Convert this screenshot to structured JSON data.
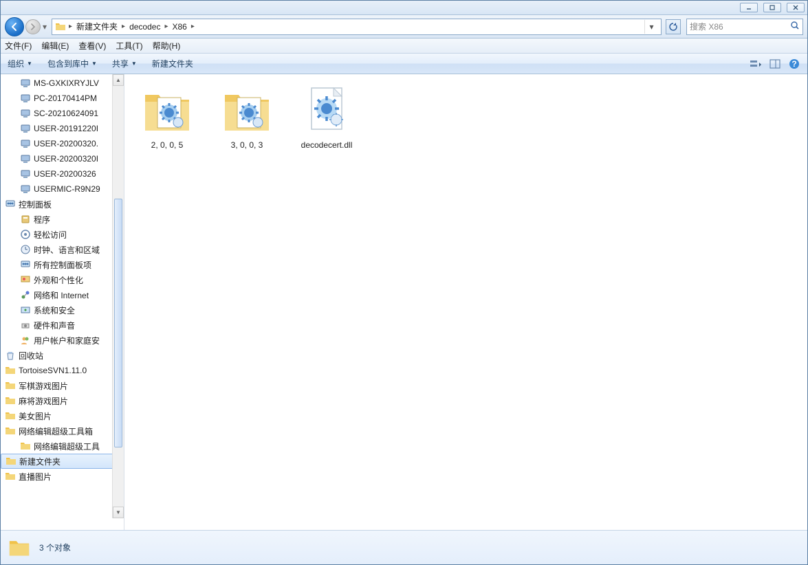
{
  "titlebar": {},
  "breadcrumb": [
    "新建文件夹",
    "decodec",
    "X86"
  ],
  "search_placeholder": "搜索 X86",
  "menubar": [
    "文件(F)",
    "编辑(E)",
    "查看(V)",
    "工具(T)",
    "帮助(H)"
  ],
  "toolbar": {
    "organize": "组织",
    "include": "包含到库中",
    "share": "共享",
    "newfolder": "新建文件夹"
  },
  "sidebar": [
    {
      "label": "MS-GXKIXRYJLV",
      "icon": "computer",
      "indent": 1
    },
    {
      "label": "PC-20170414PM",
      "icon": "computer",
      "indent": 1
    },
    {
      "label": "SC-20210624091",
      "icon": "computer",
      "indent": 1
    },
    {
      "label": "USER-20191220I",
      "icon": "computer",
      "indent": 1
    },
    {
      "label": "USER-20200320.",
      "icon": "computer",
      "indent": 1
    },
    {
      "label": "USER-20200320I",
      "icon": "computer",
      "indent": 1
    },
    {
      "label": "USER-20200326",
      "icon": "computer",
      "indent": 1
    },
    {
      "label": "USERMIC-R9N29",
      "icon": "computer",
      "indent": 1
    },
    {
      "label": "控制面板",
      "icon": "control-panel",
      "indent": 0
    },
    {
      "label": "程序",
      "icon": "programs",
      "indent": 1
    },
    {
      "label": "轻松访问",
      "icon": "ease",
      "indent": 1
    },
    {
      "label": "时钟、语言和区域",
      "icon": "clock",
      "indent": 1
    },
    {
      "label": "所有控制面板项",
      "icon": "control-panel",
      "indent": 1
    },
    {
      "label": "外观和个性化",
      "icon": "appearance",
      "indent": 1
    },
    {
      "label": "网络和 Internet",
      "icon": "network",
      "indent": 1
    },
    {
      "label": "系统和安全",
      "icon": "system",
      "indent": 1
    },
    {
      "label": "硬件和声音",
      "icon": "hardware",
      "indent": 1
    },
    {
      "label": "用户帐户和家庭安",
      "icon": "users",
      "indent": 1
    },
    {
      "label": "回收站",
      "icon": "recycle",
      "indent": 0
    },
    {
      "label": "TortoiseSVN1.11.0",
      "icon": "folder",
      "indent": 0
    },
    {
      "label": "军棋游戏图片",
      "icon": "folder",
      "indent": 0
    },
    {
      "label": "麻将游戏图片",
      "icon": "folder",
      "indent": 0
    },
    {
      "label": "美女图片",
      "icon": "folder",
      "indent": 0
    },
    {
      "label": "网络编辑超级工具箱",
      "icon": "folder",
      "indent": 0
    },
    {
      "label": "网络编辑超级工具",
      "icon": "folder",
      "indent": 1
    },
    {
      "label": "新建文件夹",
      "icon": "folder",
      "indent": 0,
      "selected": true
    },
    {
      "label": "直播图片",
      "icon": "folder",
      "indent": 0
    }
  ],
  "files": [
    {
      "name": "2, 0, 0, 5",
      "type": "folder-config"
    },
    {
      "name": "3, 0, 0, 3",
      "type": "folder-config"
    },
    {
      "name": "decodecert.dll",
      "type": "dll"
    }
  ],
  "statusbar": {
    "count": "3 个对象"
  }
}
